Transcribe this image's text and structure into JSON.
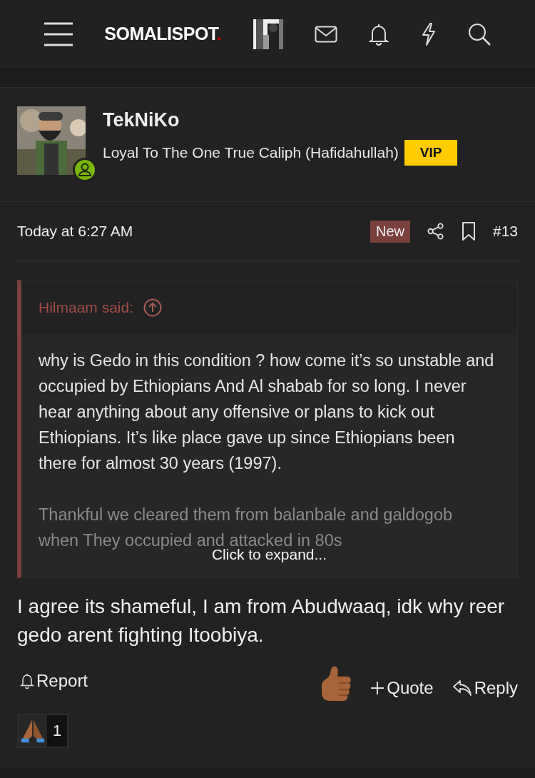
{
  "header": {
    "logo": "SOMALISPOT",
    "logo_dot": "."
  },
  "post": {
    "author": {
      "name": "TekNiKo",
      "title": "Loyal To The One True Caliph (Hafidahullah)",
      "badge": "VIP",
      "online": true
    },
    "time": "Today at 6:27 AM",
    "new_label": "New",
    "number": "#13",
    "quote": {
      "author": "Hilmaam said:",
      "paragraphs": [
        "why is Gedo in this condition ? how come it’s so unstable and occupied by Ethiopians And Al shabab for so long. I never hear anything about any offensive or plans to kick out Ethiopians. It’s like place gave up since Ethiopians been there for almost 30 years (1997).",
        "Thankful we cleared them from balanbale and galdogob when They occupied and attacked in 80s"
      ],
      "expand": "Click to expand..."
    },
    "body": "I agree its shameful, I am from Abudwaaq, idk why reer gedo arent fighting Itoobiya.",
    "actions": {
      "report": "Report",
      "quote": "Quote",
      "reply": "Reply"
    },
    "reactions": [
      {
        "count": "1"
      }
    ]
  }
}
